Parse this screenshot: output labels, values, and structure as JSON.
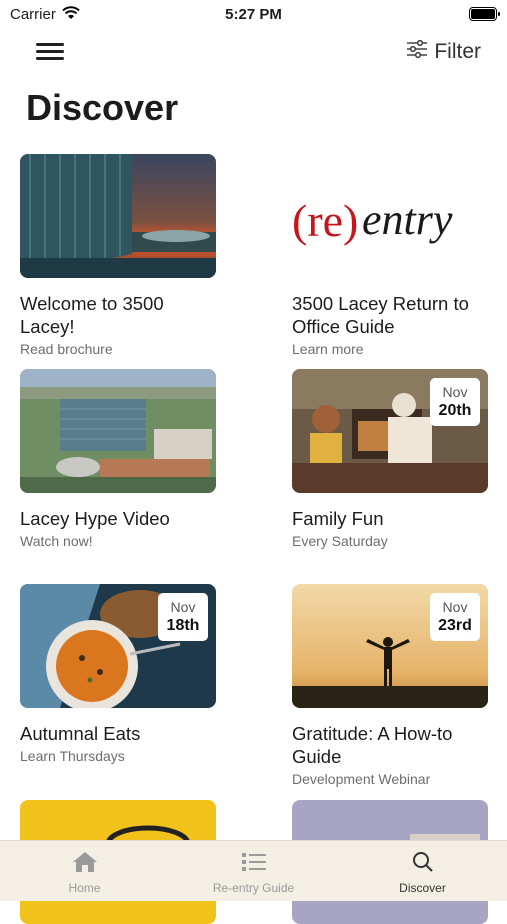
{
  "status": {
    "carrier": "Carrier",
    "time": "5:27 PM"
  },
  "header": {
    "filter_label": "Filter",
    "page_title": "Discover"
  },
  "cards": [
    {
      "title": "Welcome to 3500 Lacey!",
      "subtitle": "Read brochure",
      "image": "glass-office-building-sunset"
    },
    {
      "title": "3500 Lacey Return to Office Guide",
      "subtitle": "Learn more",
      "image": "reentry-logo",
      "logo_text_a": "(re)",
      "logo_text_b": "entry"
    },
    {
      "title": "Lacey Hype Video",
      "subtitle": "Watch now!",
      "image": "aerial-office-campus"
    },
    {
      "title": "Family Fun",
      "subtitle": "Every Saturday",
      "image": "family-baking",
      "badge": {
        "month": "Nov",
        "day": "20th"
      }
    },
    {
      "title": "Autumnal Eats",
      "subtitle": "Learn Thursdays",
      "image": "soup-bowl",
      "badge": {
        "month": "Nov",
        "day": "18th"
      }
    },
    {
      "title": "Gratitude: A How-to Guide",
      "subtitle": "Development Webinar",
      "image": "silhouette-sunset",
      "badge": {
        "month": "Nov",
        "day": "23rd"
      }
    }
  ],
  "tabs": [
    {
      "label": "Home",
      "icon": "home-icon",
      "active": false
    },
    {
      "label": "Re-entry Guide",
      "icon": "list-icon",
      "active": false
    },
    {
      "label": "Discover",
      "icon": "search-icon",
      "active": true
    }
  ],
  "colors": {
    "accent_red": "#c4161c",
    "tab_bar_bg": "#f3efe5"
  }
}
